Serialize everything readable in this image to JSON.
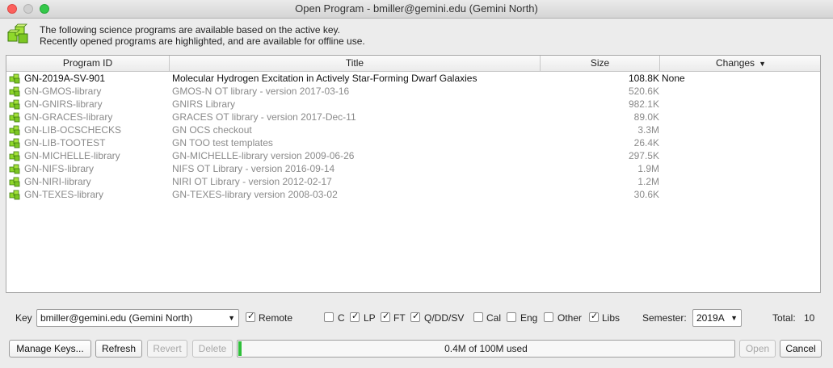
{
  "window": {
    "title": "Open Program - bmiller@gemini.edu (Gemini North)"
  },
  "header": {
    "line1": "The following science programs are available based on the active key.",
    "line2": "Recently opened programs are highlighted, and are available for offline use."
  },
  "table": {
    "columns": {
      "program_id": "Program ID",
      "title": "Title",
      "size": "Size",
      "changes": "Changes"
    },
    "rows": [
      {
        "id": "GN-2019A-SV-901",
        "title": "Molecular Hydrogen Excitation in Actively Star-Forming Dwarf Galaxies",
        "size": "108.8K",
        "changes": "None",
        "highlighted": true
      },
      {
        "id": "GN-GMOS-library",
        "title": "GMOS-N OT library - version 2017-03-16",
        "size": "520.6K",
        "changes": "",
        "highlighted": false
      },
      {
        "id": "GN-GNIRS-library",
        "title": "GNIRS Library",
        "size": "982.1K",
        "changes": "",
        "highlighted": false
      },
      {
        "id": "GN-GRACES-library",
        "title": "GRACES OT library - version 2017-Dec-11",
        "size": "89.0K",
        "changes": "",
        "highlighted": false
      },
      {
        "id": "GN-LIB-OCSCHECKS",
        "title": "GN OCS checkout",
        "size": "3.3M",
        "changes": "",
        "highlighted": false
      },
      {
        "id": "GN-LIB-TOOTEST",
        "title": "GN TOO test templates",
        "size": "26.4K",
        "changes": "",
        "highlighted": false
      },
      {
        "id": "GN-MICHELLE-library",
        "title": "GN-MICHELLE-library version 2009-06-26",
        "size": "297.5K",
        "changes": "",
        "highlighted": false
      },
      {
        "id": "GN-NIFS-library",
        "title": "NIFS OT Library - version 2016-09-14",
        "size": "1.9M",
        "changes": "",
        "highlighted": false
      },
      {
        "id": "GN-NIRI-library",
        "title": "NIRI OT Library - version 2012-02-17",
        "size": "1.2M",
        "changes": "",
        "highlighted": false
      },
      {
        "id": "GN-TEXES-library",
        "title": "GN-TEXES-library version 2008-03-02",
        "size": "30.6K",
        "changes": "",
        "highlighted": false
      }
    ]
  },
  "filters": {
    "key_label": "Key",
    "key_value": "bmiller@gemini.edu (Gemini North)",
    "remote_label": "Remote",
    "remote_checked": true,
    "c_label": "C",
    "c_checked": false,
    "lp_label": "LP",
    "lp_checked": true,
    "ft_label": "FT",
    "ft_checked": true,
    "qddsv_label": "Q/DD/SV",
    "qddsv_checked": true,
    "cal_label": "Cal",
    "cal_checked": false,
    "eng_label": "Eng",
    "eng_checked": false,
    "other_label": "Other",
    "other_checked": false,
    "libs_label": "Libs",
    "libs_checked": true,
    "semester_label": "Semester:",
    "semester_value": "2019A",
    "total_label": "Total:",
    "total_value": "10"
  },
  "buttons": {
    "manage_keys": "Manage Keys...",
    "refresh": "Refresh",
    "revert": "Revert",
    "delete": "Delete",
    "open": "Open",
    "cancel": "Cancel"
  },
  "progress": {
    "text": "0.4M of 100M used",
    "fraction": 0.004
  },
  "colors": {
    "progress_fill": "#2fbf3a",
    "program_icon": "#8fd82a"
  }
}
